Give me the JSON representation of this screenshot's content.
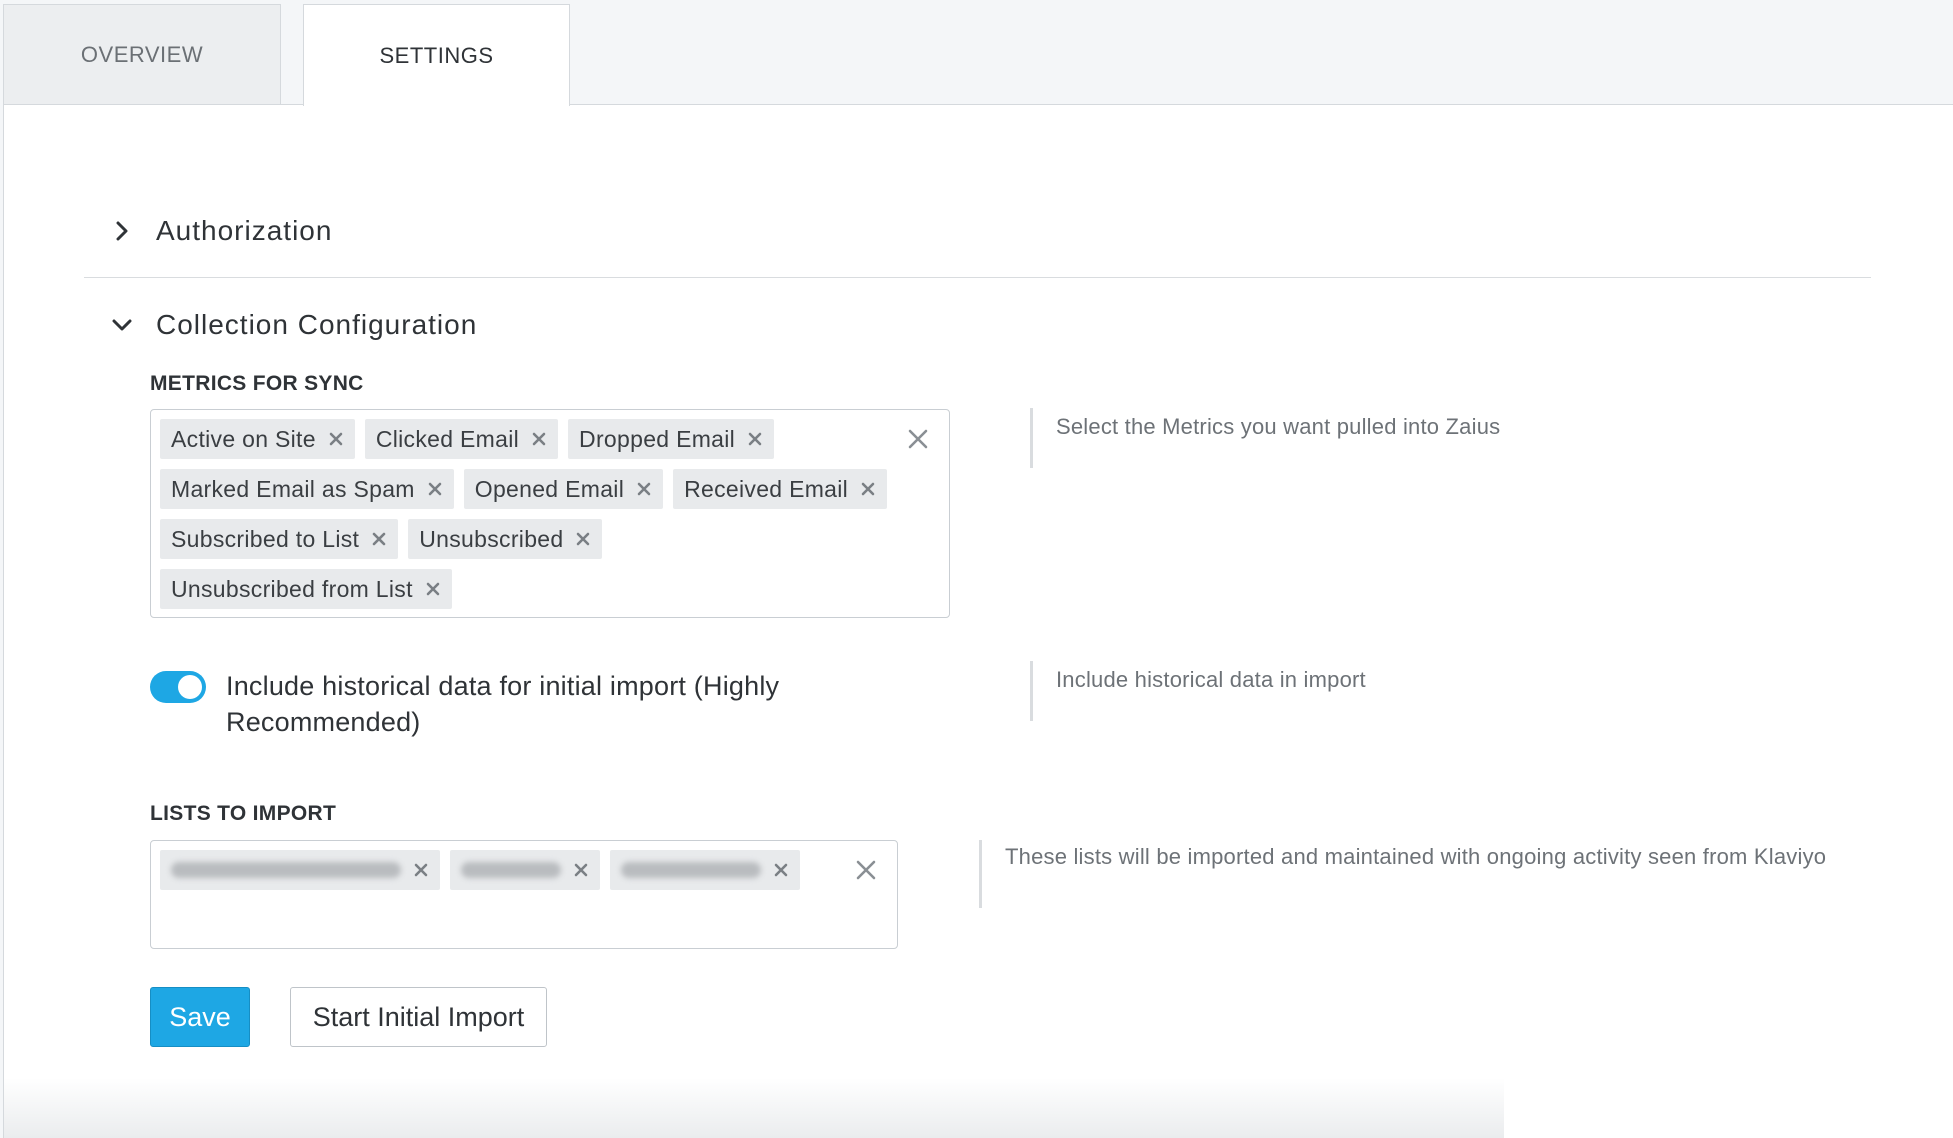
{
  "tabs": [
    {
      "label": "OVERVIEW",
      "active": false
    },
    {
      "label": "SETTINGS",
      "active": true
    }
  ],
  "sections": {
    "authorization": {
      "title": "Authorization",
      "expanded": false,
      "icon": "chevron-right-icon"
    },
    "collection": {
      "title": "Collection Configuration",
      "expanded": true,
      "icon": "chevron-down-icon"
    }
  },
  "metrics": {
    "label": "METRICS FOR SYNC",
    "help": "Select the Metrics you want pulled into Zaius",
    "chips": [
      "Active on Site",
      "Clicked Email",
      "Dropped Email",
      "Marked Email as Spam",
      "Opened Email",
      "Received Email",
      "Subscribed to List",
      "Unsubscribed",
      "Unsubscribed from List"
    ]
  },
  "historical": {
    "enabled": true,
    "label": "Include historical data for initial import (Highly Recommended)",
    "help": "Include historical data in import"
  },
  "lists": {
    "label": "LISTS TO IMPORT",
    "help": "These lists will be imported and maintained with ongoing activity seen from Klaviyo",
    "chips": [
      "redacted-list-1",
      "redacted-list-2",
      "redacted-list-3"
    ]
  },
  "buttons": {
    "save": "Save",
    "start_import": "Start Initial Import"
  },
  "colors": {
    "accent": "#1ea7e4",
    "chip_bg": "#e8eaec",
    "border": "#c9ced3"
  }
}
